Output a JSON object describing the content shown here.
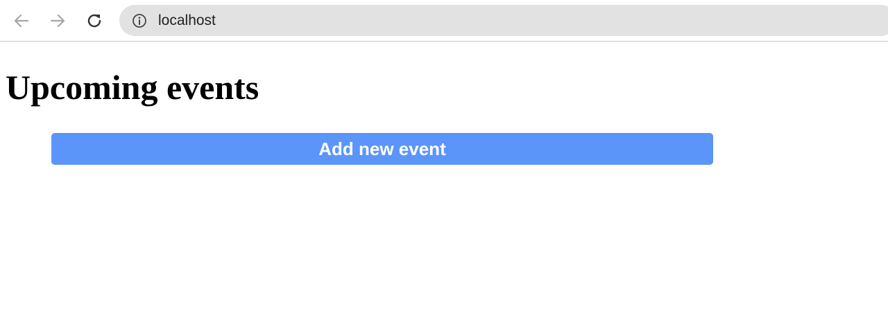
{
  "browser": {
    "back_icon": "arrow-left-icon",
    "forward_icon": "arrow-right-icon",
    "reload_icon": "reload-icon",
    "site_info_icon": "info-circle-icon",
    "url": "localhost"
  },
  "page": {
    "title": "Upcoming events",
    "add_button_label": "Add new event",
    "colors": {
      "button_background": "#5b95f9",
      "button_text": "#ffffff"
    }
  }
}
